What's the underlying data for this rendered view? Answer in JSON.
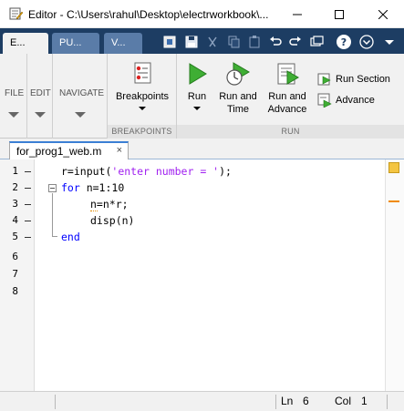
{
  "window": {
    "title": "Editor - C:\\Users\\rahul\\Desktop\\electrworkbook\\..."
  },
  "toolstrip_tabs": [
    {
      "label": "E...",
      "active": true
    },
    {
      "label": "PU...",
      "active": false
    },
    {
      "label": "V...",
      "active": false
    }
  ],
  "ribbon": {
    "file_label": "FILE",
    "edit_label": "EDIT",
    "navigate_label": "NAVIGATE",
    "breakpoints_button": "Breakpoints",
    "breakpoints_section": "BREAKPOINTS",
    "run_button": "Run",
    "run_and_time_line1": "Run and",
    "run_and_time_line2": "Time",
    "run_and_advance_line1": "Run and",
    "run_and_advance_line2": "Advance",
    "run_section_button": "Run Section",
    "advance_button": "Advance",
    "run_section_label": "RUN"
  },
  "document_tab": {
    "filename": "for_prog1_web.m",
    "close": "×"
  },
  "editor": {
    "lines": [
      {
        "num": "1",
        "code": "r=input('enter number = ');"
      },
      {
        "num": "2",
        "code": "for n=1:10"
      },
      {
        "num": "3",
        "code": "n=n*r;"
      },
      {
        "num": "4",
        "code": "disp(n)"
      },
      {
        "num": "5",
        "code": "end"
      },
      {
        "num": "6",
        "code": ""
      },
      {
        "num": "7",
        "code": ""
      },
      {
        "num": "8",
        "code": ""
      }
    ],
    "line1_var": "r=input(",
    "line1_string": "'enter number = '",
    "line1_end": ");",
    "line2_kw": "for",
    "line2_rest": " n=1:10",
    "line5_kw": "end"
  },
  "status": {
    "ln_label": "Ln",
    "ln_value": "6",
    "col_label": "Col",
    "col_value": "1"
  },
  "colors": {
    "keyword": "#0000ff",
    "string": "#a020f0",
    "toolstrip_bg": "#1d3d63",
    "ribbon_bg": "#f1f1f1"
  }
}
